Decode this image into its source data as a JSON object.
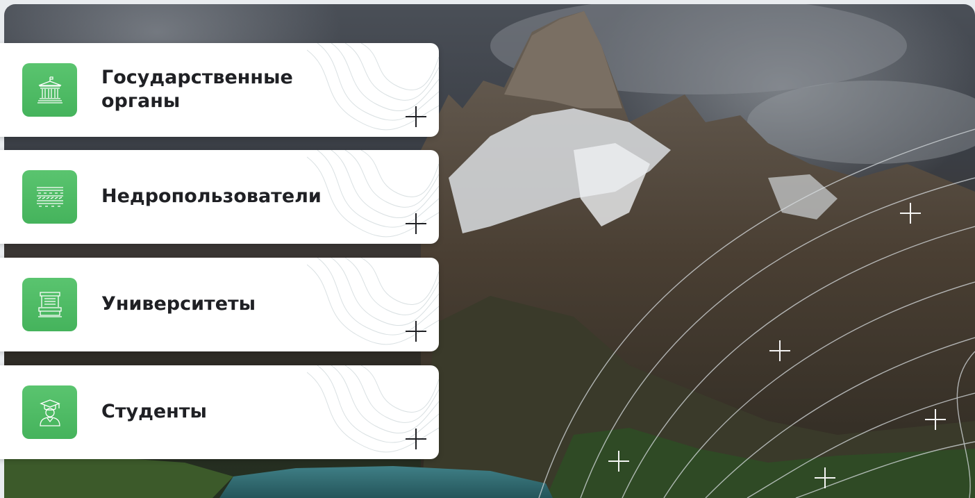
{
  "categories": [
    {
      "label": "Государственные органы",
      "icon": "government-building-icon",
      "expand_icon": "plus-icon"
    },
    {
      "label": "Недропользователи",
      "icon": "mineral-layers-icon",
      "expand_icon": "plus-icon"
    },
    {
      "label": "Университеты",
      "icon": "university-books-icon",
      "expand_icon": "plus-icon"
    },
    {
      "label": "Студенты",
      "icon": "student-graduate-icon",
      "expand_icon": "plus-icon"
    }
  ],
  "colors": {
    "accent": "#4dba63",
    "card_bg": "#ffffff",
    "text": "#1f2024"
  },
  "background": {
    "image": "mountain-landscape"
  }
}
